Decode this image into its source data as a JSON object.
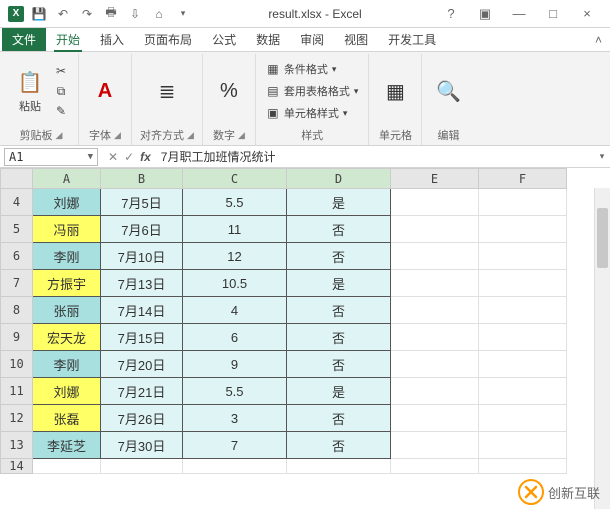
{
  "title": "result.xlsx - Excel",
  "title_ctrl": {
    "help": "?",
    "ribbon": "▣",
    "min": "—",
    "max": "□",
    "close": "×"
  },
  "tabs": {
    "file": "文件",
    "items": [
      "开始",
      "插入",
      "页面布局",
      "公式",
      "数据",
      "审阅",
      "视图",
      "开发工具"
    ],
    "active_index": 0
  },
  "ribbon": {
    "clipboard": {
      "label": "剪贴板",
      "paste": "粘贴",
      "cut_icon": "✂",
      "copy_icon": "⧉",
      "fmt_icon": "✎"
    },
    "font": {
      "label": "字体",
      "icon": "A"
    },
    "align": {
      "label": "对齐方式",
      "icon": "≣"
    },
    "number": {
      "label": "数字",
      "icon": "%"
    },
    "styles": {
      "label": "样式",
      "cond": "条件格式",
      "tbl": "套用表格格式",
      "cell": "单元格样式"
    },
    "cells": {
      "label": "单元格",
      "icon": "▦"
    },
    "editing": {
      "label": "编辑",
      "icon": "🔍"
    }
  },
  "name_box": "A1",
  "formula_btns": {
    "cancel": "✕",
    "enter": "✓",
    "fx": "fx"
  },
  "formula_bar": "7月职工加班情况统计",
  "columns": [
    "A",
    "B",
    "C",
    "D",
    "E",
    "F"
  ],
  "col_widths": {
    "A": 68,
    "B": 82,
    "C": 104,
    "D": 104,
    "E": 88,
    "F": 88
  },
  "rows": [
    {
      "n": 4,
      "A": "刘娜",
      "B": "7月5日",
      "C": "5.5",
      "D": "是",
      "class": "c-teal"
    },
    {
      "n": 5,
      "A": "冯丽",
      "B": "7月6日",
      "C": "11",
      "D": "否",
      "class": "c-yellow"
    },
    {
      "n": 6,
      "A": "李刚",
      "B": "7月10日",
      "C": "12",
      "D": "否",
      "class": "c-teal"
    },
    {
      "n": 7,
      "A": "方振宇",
      "B": "7月13日",
      "C": "10.5",
      "D": "是",
      "class": "c-yellow"
    },
    {
      "n": 8,
      "A": "张丽",
      "B": "7月14日",
      "C": "4",
      "D": "否",
      "class": "c-teal"
    },
    {
      "n": 9,
      "A": "宏天龙",
      "B": "7月15日",
      "C": "6",
      "D": "否",
      "class": "c-yellow"
    },
    {
      "n": 10,
      "A": "李刚",
      "B": "7月20日",
      "C": "9",
      "D": "否",
      "class": "c-teal"
    },
    {
      "n": 11,
      "A": "刘娜",
      "B": "7月21日",
      "C": "5.5",
      "D": "是",
      "class": "c-yellow"
    },
    {
      "n": 12,
      "A": "张磊",
      "B": "7月26日",
      "C": "3",
      "D": "否",
      "class": "c-yellow"
    },
    {
      "n": 13,
      "A": "李延芝",
      "B": "7月30日",
      "C": "7",
      "D": "否",
      "class": "c-teal"
    },
    {
      "n": 14,
      "A": "",
      "B": "",
      "C": "",
      "D": "",
      "class": "",
      "empty": true
    }
  ],
  "watermark": "创新互联"
}
